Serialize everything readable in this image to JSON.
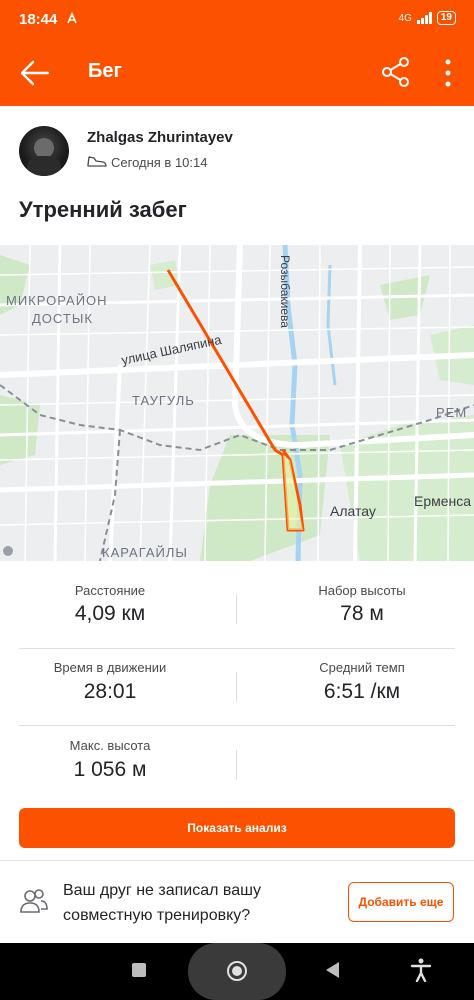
{
  "status_bar": {
    "time": "18:44",
    "activity_icon": "strava-notification-icon",
    "network": "4G",
    "battery": "19"
  },
  "app_bar": {
    "title": "Бег",
    "back_icon": "arrow-left-icon",
    "share_icon": "share-icon",
    "more_icon": "more-vertical-icon"
  },
  "activity": {
    "athlete_name": "Zhalgas Zhurintayev",
    "date": "Сегодня в 10:14",
    "title": "Утренний забег"
  },
  "map": {
    "labels": {
      "district_1_line1": "МИКРОРАЙОН",
      "district_1_line2": "ДОСТЫК",
      "street_1": "улица Шаляпина",
      "street_2": "Розыбакиева",
      "district_2": "ТАУГУЛЬ",
      "district_3": "КАРАГАЙЛЫ",
      "district_4": "РЕМ",
      "place_1": "Алатау",
      "place_2": "Ерменса"
    },
    "route_color": "#fc5200"
  },
  "stats": {
    "distance_label": "Расстояние",
    "distance_value": "4,09 км",
    "elevation_label": "Набор высоты",
    "elevation_value": "78 м",
    "moving_time_label": "Время в движении",
    "moving_time_value": "28:01",
    "pace_label": "Средний темп",
    "pace_value": "6:51 /км",
    "max_elev_label": "Макс. высота",
    "max_elev_value": "1 056 м"
  },
  "actions": {
    "analysis_button": "Показать анализ"
  },
  "friend_prompt": {
    "text": "Ваш друг не записал вашу совместную тренировку?",
    "add_button": "Добавить еще"
  },
  "colors": {
    "brand": "#fc5200",
    "text": "#242428"
  }
}
